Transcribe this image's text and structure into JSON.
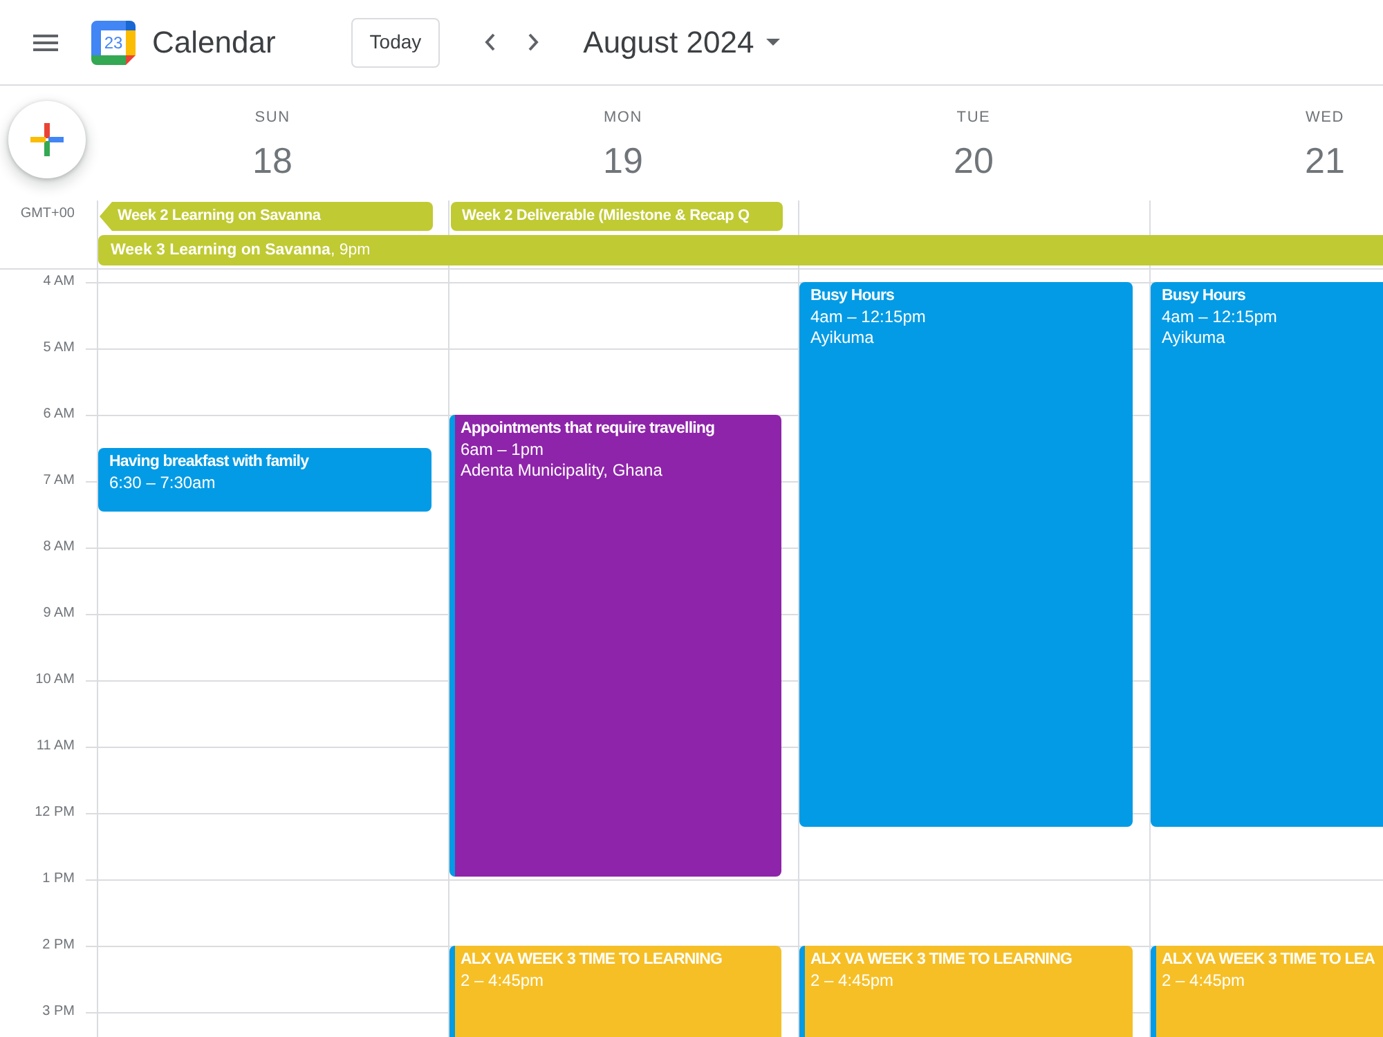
{
  "app": {
    "name": "Calendar",
    "logo_day": "23"
  },
  "toolbar": {
    "today": "Today",
    "period": "August 2024"
  },
  "timezone": "GMT+00",
  "days": [
    {
      "weekday": "SUN",
      "date": "18",
      "all_day": [
        {
          "title": "Week 2 Learning on Savanna",
          "continues_before": true,
          "color": "#c0ca33"
        }
      ],
      "events": [
        {
          "title": "Having breakfast with family",
          "time": "6:30 – 7:30am",
          "color": "#039be5",
          "overlap": false
        }
      ]
    },
    {
      "weekday": "MON",
      "date": "19",
      "all_day": [
        {
          "title": "Week 2 Deliverable (Milestone & Recap Q",
          "continues_before": false,
          "color": "#c0ca33"
        }
      ],
      "events": [
        {
          "title": "Appointments that require travelling",
          "time": "6am – 1pm",
          "location": "Adenta Municipality, Ghana",
          "color": "#8e24aa",
          "overlap": true
        },
        {
          "title": "ALX VA WEEK 3 TIME TO LEARNING",
          "time": "2 – 4:45pm",
          "color": "#f6bf26",
          "overlap": true
        }
      ]
    },
    {
      "weekday": "TUE",
      "date": "20",
      "events": [
        {
          "title": "Busy Hours",
          "time": "4am – 12:15pm",
          "location": "Ayikuma",
          "color": "#039be5",
          "overlap": false
        },
        {
          "title": "ALX VA WEEK 3 TIME TO LEARNING",
          "time": "2 – 4:45pm",
          "color": "#f6bf26",
          "overlap": true
        }
      ]
    },
    {
      "weekday": "WED",
      "date": "21",
      "events": [
        {
          "title": "Busy Hours",
          "time": "4am – 12:15pm",
          "location": "Ayikuma",
          "color": "#039be5",
          "overlap": false
        },
        {
          "title": "ALX VA WEEK 3 TIME TO LEA",
          "time": "2 – 4:45pm",
          "color": "#f6bf26",
          "overlap": true
        }
      ]
    }
  ],
  "banners": [
    {
      "title": "**Week 3 Learning on Savanna**, 9pm",
      "color": "#c0ca33"
    }
  ],
  "hours": [
    "4 AM",
    "5 AM",
    "6 AM",
    "7 AM",
    "8 AM",
    "9 AM",
    "10 AM",
    "11 AM",
    "12 PM",
    "1 PM",
    "2 PM",
    "3 PM"
  ]
}
